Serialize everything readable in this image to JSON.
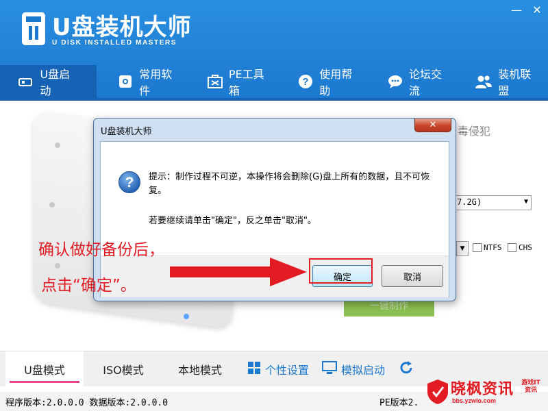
{
  "app": {
    "title": "U盘装机大师",
    "subtitle": "U DISK INSTALLED MASTERS"
  },
  "window_controls": {
    "minimize": "—",
    "close": "✕"
  },
  "nav": {
    "items": [
      {
        "label": "U盘启动",
        "icon": "usb-drive-icon",
        "active": true
      },
      {
        "label": "常用软件",
        "icon": "software-icon",
        "active": false
      },
      {
        "label": "PE工具箱",
        "icon": "toolbox-icon",
        "active": false
      },
      {
        "label": "使用帮助",
        "icon": "help-icon",
        "active": false
      },
      {
        "label": "论坛交流",
        "icon": "chat-icon",
        "active": false
      },
      {
        "label": "装机联盟",
        "icon": "users-icon",
        "active": false
      }
    ]
  },
  "background": {
    "tab_partial": "毒侵犯",
    "disk_select_value": "7.2G)",
    "checkbox_ntfs": "NTFS",
    "checkbox_chs": "CHS",
    "green_button": "一键制作"
  },
  "dialog": {
    "title": "U盘装机大师",
    "close_glyph": "✕",
    "message": "提示：制作过程不可逆，本操作将会删除(G)盘上所有的数据，且不可恢复。",
    "message2": "若要继续请单击\"确定\"，反之单击\"取消\"。",
    "ok_label": "确定",
    "cancel_label": "取消"
  },
  "annotation": {
    "line1": "确认做好备份后，",
    "line2": "点击“确定”。",
    "color": "#e31b23"
  },
  "bottom_tabs": [
    {
      "label": "U盘模式",
      "active": true
    },
    {
      "label": "ISO模式",
      "active": false
    },
    {
      "label": "本地模式",
      "active": false
    },
    {
      "label": "个性设置",
      "icon": "grid-icon"
    },
    {
      "label": "模拟启动",
      "icon": "monitor-icon"
    }
  ],
  "status": {
    "left": "程序版本:2.0.0.0  数据版本:2.0.0.0",
    "right": "PE版本2."
  },
  "watermark": {
    "name": "晓枫资讯",
    "url": "bbs.yzwlo.com",
    "side": "游戏IT资讯"
  },
  "colors": {
    "header_blue": "#1b78cf",
    "active_tab": "#1662b5",
    "accent_pink": "#e8448e",
    "alert_red": "#e31b23"
  }
}
